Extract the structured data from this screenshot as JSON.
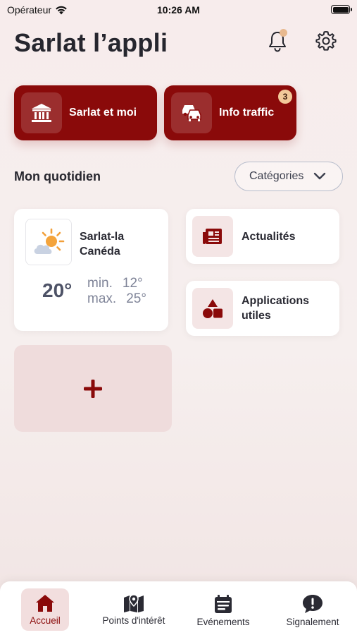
{
  "status_bar": {
    "carrier": "Opérateur",
    "time": "10:26 AM"
  },
  "header": {
    "title": "Sarlat l’appli"
  },
  "quick_actions": [
    {
      "label": "Sarlat et moi",
      "icon": "town-hall-icon"
    },
    {
      "label": "Info traffic",
      "icon": "cars-icon",
      "badge": "3"
    }
  ],
  "section": {
    "title": "Mon quotidien",
    "categories_label": "Catégories"
  },
  "weather": {
    "city": "Sarlat-la Canéda",
    "temperature": "20°",
    "min_label": "min.",
    "min_value": "12°",
    "max_label": "max.",
    "max_value": "25°",
    "icon": "partly-sunny-icon"
  },
  "tiles": [
    {
      "label": "Actualités",
      "icon": "newspaper-icon"
    },
    {
      "label": "Applications utiles",
      "icon": "shapes-icon"
    }
  ],
  "add_tile": {
    "icon": "plus-icon"
  },
  "tab_bar": {
    "items": [
      {
        "label": "Accueil",
        "icon": "home-icon",
        "active": true
      },
      {
        "label": "Points d'intérêt",
        "icon": "map-pin-icon",
        "active": false
      },
      {
        "label": "Evénements",
        "icon": "calendar-icon",
        "active": false
      },
      {
        "label": "Signalement",
        "icon": "alert-chat-icon",
        "active": false
      }
    ]
  },
  "colors": {
    "brand": "#8a0a0a",
    "badge": "#f3c99a",
    "notification_dot": "#e8b98f",
    "tile_icon_bg": "#f4e5e5",
    "add_tile_bg": "#efdcdc"
  }
}
